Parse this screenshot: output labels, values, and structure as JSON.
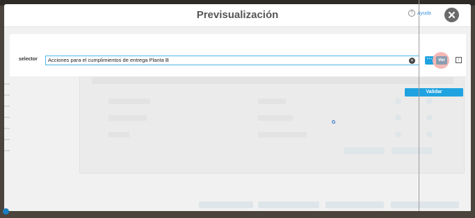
{
  "modal": {
    "title": "Previsualización",
    "help_label": "Ayuda",
    "close_icon": "close-icon"
  },
  "selector": {
    "label": "selector",
    "value": "Acciones para el cumplimientos de entrega Planta B",
    "view_button": "Ver",
    "more_button": "···"
  },
  "actions": {
    "validate_button": "Validar"
  },
  "colors": {
    "accent": "#1fa3e0",
    "title": "#555555",
    "highlight": "#f4b8b5"
  }
}
